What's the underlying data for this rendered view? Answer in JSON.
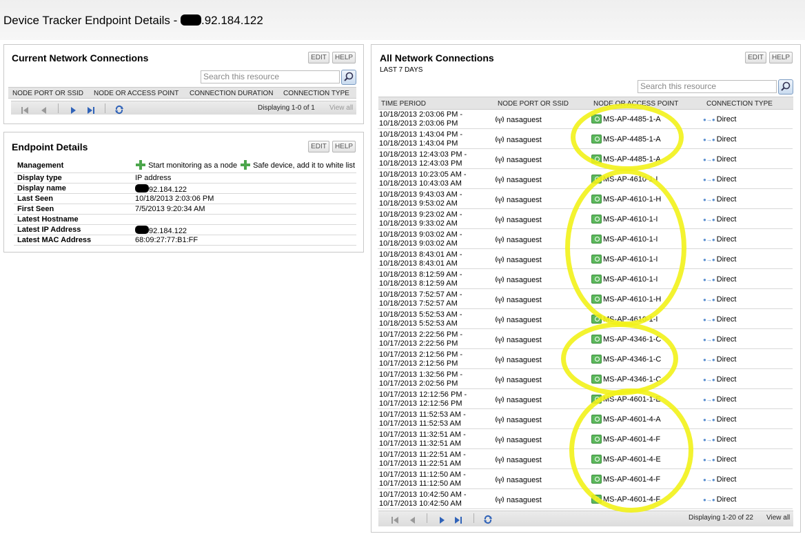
{
  "page": {
    "title_prefix": "Device Tracker Endpoint Details - ",
    "title_ip": ".92.184.122"
  },
  "current_connections": {
    "title": "Current Network Connections",
    "edit": "EDIT",
    "help": "HELP",
    "search_placeholder": "Search this resource",
    "columns": [
      "NODE PORT OR SSID",
      "NODE OR ACCESS POINT",
      "CONNECTION DURATION",
      "CONNECTION TYPE"
    ],
    "displaying": "Displaying 1-0 of 1",
    "view_all": "View all"
  },
  "endpoint_details": {
    "title": "Endpoint Details",
    "edit": "EDIT",
    "help": "HELP",
    "management_label": "Management",
    "start_monitoring": "Start monitoring as a node",
    "safe_device": "Safe device, add it to white list",
    "rows": [
      {
        "key": "Display type",
        "value": "IP address"
      },
      {
        "key": "Display name",
        "value": "92.184.122"
      },
      {
        "key": "Last Seen",
        "value": "10/18/2013 2:03:06 PM"
      },
      {
        "key": "First Seen",
        "value": "7/5/2013 9:20:34 AM"
      },
      {
        "key": "Latest Hostname",
        "value": ""
      },
      {
        "key": "Latest IP Address",
        "value": "92.184.122"
      },
      {
        "key": "Latest MAC Address",
        "value": "68:09:27:77:B1:FF"
      }
    ]
  },
  "all_connections": {
    "title": "All Network Connections",
    "subtitle": "LAST 7 DAYS",
    "edit": "EDIT",
    "help": "HELP",
    "search_placeholder": "Search this resource",
    "columns": [
      "TIME PERIOD",
      "NODE PORT OR SSID",
      "NODE OR ACCESS POINT",
      "CONNECTION TYPE"
    ],
    "rows": [
      {
        "t1": "10/18/2013 2:03:06 PM -",
        "t2": "10/18/2013 2:03:06 PM",
        "ssid": "nasaguest",
        "ap": "MS-AP-4485-1-A",
        "type": "Direct"
      },
      {
        "t1": "10/18/2013 1:43:04 PM -",
        "t2": "10/18/2013 1:43:04 PM",
        "ssid": "nasaguest",
        "ap": "MS-AP-4485-1-A",
        "type": "Direct"
      },
      {
        "t1": "10/18/2013 12:43:03 PM -",
        "t2": "10/18/2013 12:43:03 PM",
        "ssid": "nasaguest",
        "ap": "MS-AP-4485-1-A",
        "type": "Direct"
      },
      {
        "t1": "10/18/2013 10:23:05 AM -",
        "t2": "10/18/2013 10:43:03 AM",
        "ssid": "nasaguest",
        "ap": "MS-AP-4610-1-I",
        "type": "Direct"
      },
      {
        "t1": "10/18/2013 9:43:03 AM -",
        "t2": "10/18/2013 9:53:02 AM",
        "ssid": "nasaguest",
        "ap": "MS-AP-4610-1-H",
        "type": "Direct"
      },
      {
        "t1": "10/18/2013 9:23:02 AM -",
        "t2": "10/18/2013 9:33:02 AM",
        "ssid": "nasaguest",
        "ap": "MS-AP-4610-1-I",
        "type": "Direct"
      },
      {
        "t1": "10/18/2013 9:03:02 AM -",
        "t2": "10/18/2013 9:03:02 AM",
        "ssid": "nasaguest",
        "ap": "MS-AP-4610-1-I",
        "type": "Direct"
      },
      {
        "t1": "10/18/2013 8:43:01 AM -",
        "t2": "10/18/2013 8:43:01 AM",
        "ssid": "nasaguest",
        "ap": "MS-AP-4610-1-I",
        "type": "Direct"
      },
      {
        "t1": "10/18/2013 8:12:59 AM -",
        "t2": "10/18/2013 8:12:59 AM",
        "ssid": "nasaguest",
        "ap": "MS-AP-4610-1-I",
        "type": "Direct"
      },
      {
        "t1": "10/18/2013 7:52:57 AM -",
        "t2": "10/18/2013 7:52:57 AM",
        "ssid": "nasaguest",
        "ap": "MS-AP-4610-1-H",
        "type": "Direct"
      },
      {
        "t1": "10/18/2013 5:52:53 AM -",
        "t2": "10/18/2013 5:52:53 AM",
        "ssid": "nasaguest",
        "ap": "MS-AP-4610-1-I",
        "type": "Direct"
      },
      {
        "t1": "10/17/2013 2:22:56 PM -",
        "t2": "10/17/2013 2:22:56 PM",
        "ssid": "nasaguest",
        "ap": "MS-AP-4346-1-C",
        "type": "Direct"
      },
      {
        "t1": "10/17/2013 2:12:56 PM -",
        "t2": "10/17/2013 2:12:56 PM",
        "ssid": "nasaguest",
        "ap": "MS-AP-4346-1-C",
        "type": "Direct"
      },
      {
        "t1": "10/17/2013 1:32:56 PM -",
        "t2": "10/17/2013 2:02:56 PM",
        "ssid": "nasaguest",
        "ap": "MS-AP-4346-1-C",
        "type": "Direct"
      },
      {
        "t1": "10/17/2013 12:12:56 PM -",
        "t2": "10/17/2013 12:12:56 PM",
        "ssid": "nasaguest",
        "ap": "MS-AP-4601-1-E",
        "type": "Direct"
      },
      {
        "t1": "10/17/2013 11:52:53 AM -",
        "t2": "10/17/2013 11:52:53 AM",
        "ssid": "nasaguest",
        "ap": "MS-AP-4601-4-A",
        "type": "Direct"
      },
      {
        "t1": "10/17/2013 11:32:51 AM -",
        "t2": "10/17/2013 11:32:51 AM",
        "ssid": "nasaguest",
        "ap": "MS-AP-4601-4-F",
        "type": "Direct"
      },
      {
        "t1": "10/17/2013 11:22:51 AM -",
        "t2": "10/17/2013 11:22:51 AM",
        "ssid": "nasaguest",
        "ap": "MS-AP-4601-4-E",
        "type": "Direct"
      },
      {
        "t1": "10/17/2013 11:12:50 AM -",
        "t2": "10/17/2013 11:12:50 AM",
        "ssid": "nasaguest",
        "ap": "MS-AP-4601-4-F",
        "type": "Direct"
      },
      {
        "t1": "10/17/2013 10:42:50 AM -",
        "t2": "10/17/2013 10:42:50 AM",
        "ssid": "nasaguest",
        "ap": "MS-AP-4601-4-F",
        "type": "Direct"
      }
    ],
    "displaying": "Displaying 1-20 of 22",
    "view_all": "View all"
  },
  "colors": {
    "highlight": "#f2f21a",
    "ap_icon": "#5cb85c",
    "nav_arrow": "#2f62b8"
  }
}
